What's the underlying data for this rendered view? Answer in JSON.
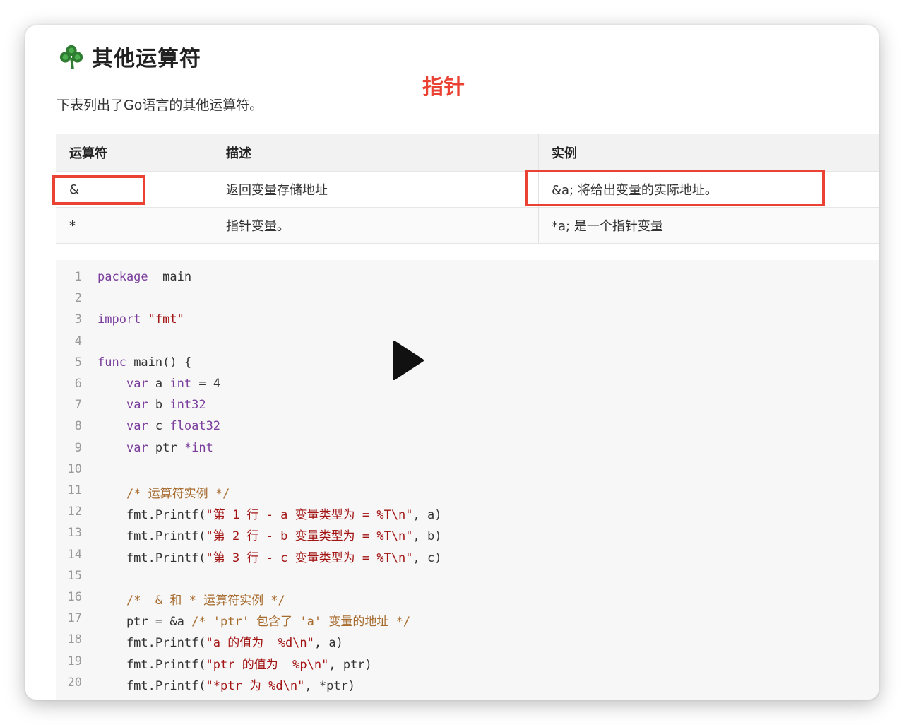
{
  "page": {
    "heading": "其他运算符",
    "annotation": "指针",
    "intro": "下表列出了Go语言的其他运算符。"
  },
  "table": {
    "headers": [
      "运算符",
      "描述",
      "实例"
    ],
    "rows": [
      [
        "&",
        "返回变量存储地址",
        "&a; 将给出变量的实际地址。"
      ],
      [
        "*",
        "指针变量。",
        "*a; 是一个指针变量"
      ]
    ]
  },
  "code": {
    "lines": [
      {
        "n": "1",
        "seg": [
          [
            "kw",
            "package"
          ],
          [
            "",
            "  main"
          ]
        ]
      },
      {
        "n": "2",
        "seg": []
      },
      {
        "n": "3",
        "seg": [
          [
            "kw",
            "import"
          ],
          [
            "",
            " "
          ],
          [
            "str",
            "\"fmt\""
          ]
        ]
      },
      {
        "n": "4",
        "seg": []
      },
      {
        "n": "5",
        "seg": [
          [
            "kw",
            "func"
          ],
          [
            "",
            " main() {"
          ]
        ]
      },
      {
        "n": "6",
        "seg": [
          [
            "",
            "    "
          ],
          [
            "kw",
            "var"
          ],
          [
            "",
            " a "
          ],
          [
            "kw",
            "int"
          ],
          [
            "",
            " = 4"
          ]
        ]
      },
      {
        "n": "7",
        "seg": [
          [
            "",
            "    "
          ],
          [
            "kw",
            "var"
          ],
          [
            "",
            " b "
          ],
          [
            "kw",
            "int32"
          ]
        ]
      },
      {
        "n": "8",
        "seg": [
          [
            "",
            "    "
          ],
          [
            "kw",
            "var"
          ],
          [
            "",
            " c "
          ],
          [
            "kw",
            "float32"
          ]
        ]
      },
      {
        "n": "9",
        "seg": [
          [
            "",
            "    "
          ],
          [
            "kw",
            "var"
          ],
          [
            "",
            " ptr "
          ],
          [
            "kw",
            "*int"
          ]
        ]
      },
      {
        "n": "10",
        "seg": []
      },
      {
        "n": "11",
        "seg": [
          [
            "",
            "    "
          ],
          [
            "cm",
            "/* 运算符实例 */"
          ]
        ]
      },
      {
        "n": "12",
        "seg": [
          [
            "",
            "    fmt.Printf("
          ],
          [
            "str",
            "\"第 1 行 - a 变量类型为 = %T\\n\""
          ],
          [
            "",
            ", a)"
          ]
        ]
      },
      {
        "n": "13",
        "seg": [
          [
            "",
            "    fmt.Printf("
          ],
          [
            "str",
            "\"第 2 行 - b 变量类型为 = %T\\n\""
          ],
          [
            "",
            ", b)"
          ]
        ]
      },
      {
        "n": "14",
        "seg": [
          [
            "",
            "    fmt.Printf("
          ],
          [
            "str",
            "\"第 3 行 - c 变量类型为 = %T\\n\""
          ],
          [
            "",
            ", c)"
          ]
        ]
      },
      {
        "n": "15",
        "seg": []
      },
      {
        "n": "16",
        "seg": [
          [
            "",
            "    "
          ],
          [
            "cm",
            "/*  & 和 * 运算符实例 */"
          ]
        ]
      },
      {
        "n": "17",
        "seg": [
          [
            "",
            "    ptr = &a "
          ],
          [
            "cm",
            "/* 'ptr' 包含了 'a' 变量的地址 */"
          ]
        ]
      },
      {
        "n": "18",
        "seg": [
          [
            "",
            "    fmt.Printf("
          ],
          [
            "str",
            "\"a 的值为  %d\\n\""
          ],
          [
            "",
            ", a)"
          ]
        ]
      },
      {
        "n": "19",
        "seg": [
          [
            "",
            "    fmt.Printf("
          ],
          [
            "str",
            "\"ptr 的值为  %p\\n\""
          ],
          [
            "",
            ", ptr)"
          ]
        ]
      },
      {
        "n": "20",
        "seg": [
          [
            "",
            "    fmt.Printf("
          ],
          [
            "str",
            "\"*ptr 为 %d\\n\""
          ],
          [
            "",
            ", *ptr)"
          ]
        ]
      }
    ]
  },
  "player": {
    "icon": "play-icon"
  },
  "colors": {
    "annotation_red": "#ea4333",
    "clover_green": "#2e7d32",
    "keyword": "#7a3e9d",
    "string": "#a31515",
    "comment": "#a76b2e"
  }
}
